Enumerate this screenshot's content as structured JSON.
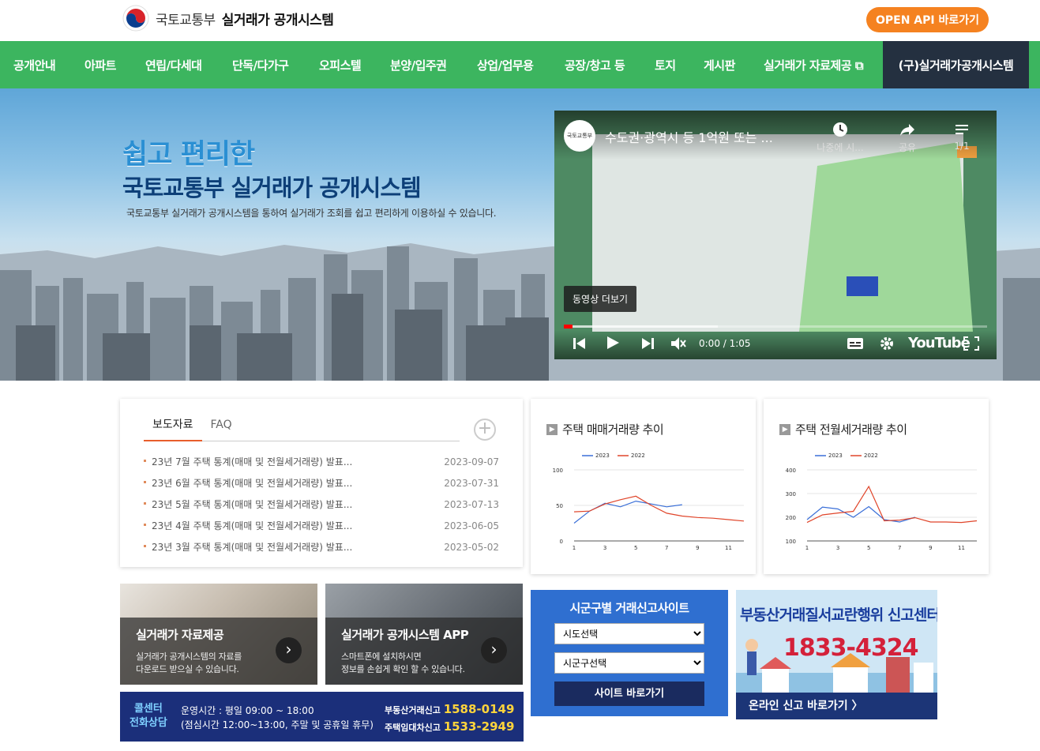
{
  "header": {
    "logo_prefix": "국토교통부",
    "logo_title": "실거래가 공개시스템",
    "open_api": "OPEN API 바로가기"
  },
  "nav": {
    "items": [
      "공개안내",
      "아파트",
      "연립/다세대",
      "단독/다가구",
      "오피스텔",
      "분양/입주권",
      "상업/업무용",
      "공장/창고 등",
      "토지",
      "게시판",
      "실거래가 자료제공 ⧉"
    ],
    "old_system": "(구)실거래가공개시스템"
  },
  "hero": {
    "slogan1": "쉽고 편리한",
    "slogan2": "국토교통부 실거래가 공개시스템",
    "desc": "국토교통부 실거래가 공개시스템을 통하여 실거래가 조회를 쉽고 편리하게 이용하실 수 있습니다."
  },
  "video": {
    "channel": "국토교통부",
    "title": "수도권·광역시 등 1억원 또는 ...",
    "watch_later": "나중에 시...",
    "share": "공유",
    "playlist": "1/1",
    "more": "동영상 더보기",
    "time": "0:00 / 1:05",
    "brand": "YouTube",
    "progress": 0.02
  },
  "news": {
    "tabs": [
      "보도자료",
      "FAQ"
    ],
    "items": [
      {
        "title": "23년 7월 주택 통계(매매 및 전월세거래량) 발표...",
        "date": "2023-09-07"
      },
      {
        "title": "23년 6월 주택 통계(매매 및 전월세거래량) 발표...",
        "date": "2023-07-31"
      },
      {
        "title": "23년 5월 주택 통계(매매 및 전월세거래량) 발표...",
        "date": "2023-07-13"
      },
      {
        "title": "23년 4월 주택 통계(매매 및 전월세거래량) 발표...",
        "date": "2023-06-05"
      },
      {
        "title": "23년 3월 주택 통계(매매 및 전월세거래량) 발표...",
        "date": "2023-05-02"
      }
    ]
  },
  "chart_data": [
    {
      "type": "line",
      "title": "주택 매매거래량 추이",
      "x": [
        1,
        2,
        3,
        4,
        5,
        6,
        7,
        8,
        9,
        10,
        11,
        12
      ],
      "xticks": [
        1,
        3,
        5,
        7,
        9,
        11
      ],
      "yticks": [
        0,
        50,
        100
      ],
      "ylim": [
        0,
        100
      ],
      "series": [
        {
          "name": "2023",
          "color": "#3a6fd8",
          "values": [
            25,
            42,
            53,
            48,
            56,
            52,
            48,
            51
          ]
        },
        {
          "name": "2022",
          "color": "#e0452a",
          "values": [
            41,
            42,
            52,
            58,
            63,
            50,
            39,
            35,
            33,
            32,
            30,
            28
          ]
        }
      ],
      "legend": "top-left"
    },
    {
      "type": "line",
      "title": "주택 전월세거래량 추이",
      "x": [
        1,
        2,
        3,
        4,
        5,
        6,
        7,
        8,
        9,
        10,
        11,
        12
      ],
      "xticks": [
        1,
        3,
        5,
        7,
        9,
        11
      ],
      "yticks": [
        100,
        200,
        300,
        400
      ],
      "ylim": [
        100,
        400
      ],
      "series": [
        {
          "name": "2023",
          "color": "#3a6fd8",
          "values": [
            190,
            243,
            235,
            200,
            245,
            190,
            180,
            200
          ]
        },
        {
          "name": "2022",
          "color": "#e0452a",
          "values": [
            178,
            210,
            218,
            225,
            330,
            185,
            188,
            198,
            180,
            180,
            178,
            185
          ]
        }
      ],
      "legend": "top-left"
    }
  ],
  "promos": [
    {
      "title": "실거래가 자료제공",
      "desc1": "실거래가 공개시스템의 자료를",
      "desc2": "다운로드 받으실 수 있습니다."
    },
    {
      "title": "실거래가 공개시스템 APP",
      "desc1": "스마트폰에 설치하시면",
      "desc2": "정보를 손쉽게 확인 할 수 있습니다."
    }
  ],
  "call": {
    "label1": "콜센터",
    "label2": "전화상담",
    "hours": "운영시간 : 평일 09:00 ~ 18:00",
    "lunch": "(점심시간 12:00~13:00, 주말 및 공휴일 휴무)",
    "line1_label": "부동산거래신고",
    "line1_num": "1588-0149",
    "line2_label": "주택임대차신고",
    "line2_num": "1533-2949"
  },
  "site": {
    "title": "시군구별 거래신고사이트",
    "sido": "시도선택",
    "sigungu": "시군구선택",
    "button": "사이트 바로가기"
  },
  "report": {
    "title": "부동산거래질서교란행위 신고센터",
    "phone": "1833-4324",
    "link": "온라인 신고 바로가기 〉"
  }
}
